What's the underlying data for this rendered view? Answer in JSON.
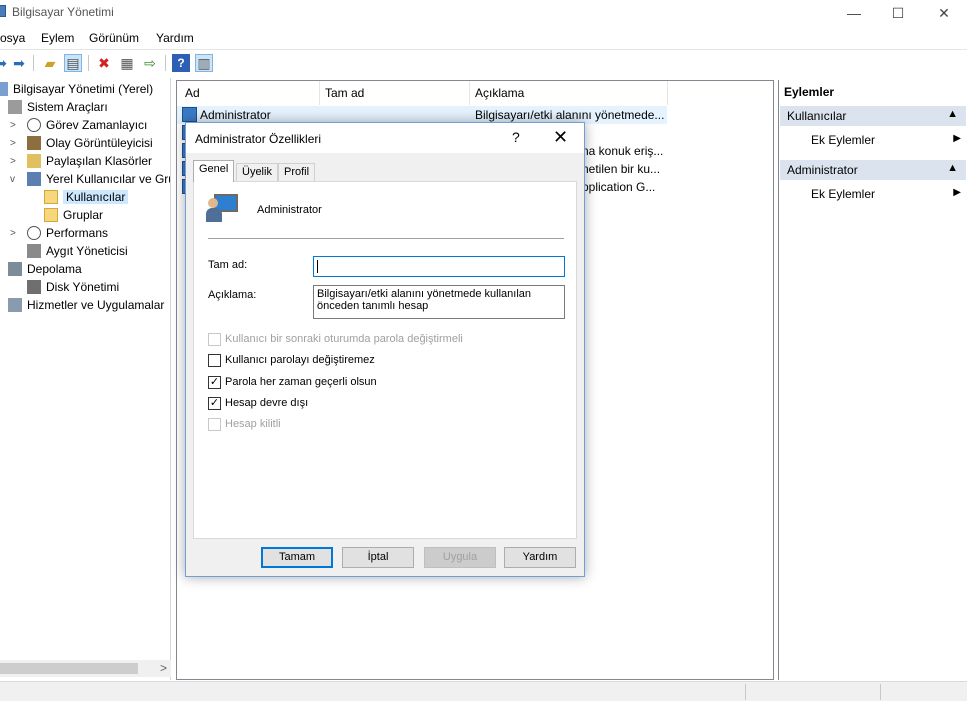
{
  "window": {
    "title": "Bilgisayar Yönetimi",
    "minimize_glyph": "—",
    "maximize_glyph": "☐",
    "close_glyph": "✕"
  },
  "menu": [
    "osya",
    "Eylem",
    "Görünüm",
    "Yardım"
  ],
  "toolbar": {
    "icons": [
      "back-icon",
      "forward-icon",
      "up-folder-icon",
      "show-hide-tree-icon",
      "delete-icon",
      "properties-icon",
      "export-icon",
      "help-icon",
      "action-pane-icon"
    ]
  },
  "tree": {
    "items": [
      {
        "label": "Bilgisayar Yönetimi (Yerel)",
        "icon": "computer-management-icon"
      },
      {
        "label": "Sistem Araçları",
        "icon": "tools-icon",
        "toggle": ""
      },
      {
        "label": "Görev Zamanlayıcı",
        "icon": "clock-icon",
        "toggle": ">"
      },
      {
        "label": "Olay Görüntüleyicisi",
        "icon": "event-viewer-icon",
        "toggle": ">"
      },
      {
        "label": "Paylaşılan Klasörler",
        "icon": "shared-folder-icon",
        "toggle": ">"
      },
      {
        "label": "Yerel Kullanıcılar ve Gru",
        "icon": "users-group-icon",
        "toggle": "v"
      },
      {
        "label": "Kullanıcılar",
        "icon": "folder-icon"
      },
      {
        "label": "Gruplar",
        "icon": "folder-icon"
      },
      {
        "label": "Performans",
        "icon": "performance-icon",
        "toggle": ">"
      },
      {
        "label": "Aygıt Yöneticisi",
        "icon": "device-manager-icon"
      },
      {
        "label": "Depolama",
        "icon": "storage-icon"
      },
      {
        "label": "Disk Yönetimi",
        "icon": "disk-icon"
      },
      {
        "label": "Hizmetler ve Uygulamalar",
        "icon": "services-icon"
      }
    ],
    "scroll_right": ">"
  },
  "list": {
    "columns": [
      "Ad",
      "Tam ad",
      "Açıklama"
    ],
    "rows": [
      {
        "name": "Administrator",
        "full_name": "",
        "description": "Bilgisayarı/etki alanını yönetmede..."
      },
      {
        "name": "",
        "full_name": "",
        "description": ""
      },
      {
        "name": "",
        "full_name": "",
        "description": "na konuk eriş..."
      },
      {
        "name": "",
        "full_name": "",
        "description": "netilen bir ku..."
      },
      {
        "name": "",
        "full_name": "",
        "description": "pplication G..."
      }
    ]
  },
  "actions": {
    "title": "Eylemler",
    "sections": [
      {
        "header": "Kullanıcılar",
        "items": [
          "Ek Eylemler"
        ]
      },
      {
        "header": "Administrator",
        "items": [
          "Ek Eylemler"
        ]
      }
    ]
  },
  "dialog": {
    "title": "Administrator Özellikleri",
    "help_glyph": "?",
    "close_glyph": "✕",
    "tabs": [
      "Genel",
      "Üyelik",
      "Profil"
    ],
    "user_name": "Administrator",
    "full_name_label": "Tam ad:",
    "full_name_value": "",
    "description_label": "Açıklama:",
    "description_value": "Bilgisayarı/etki alanını yönetmede kullanılan önceden tanımlı hesap",
    "checkboxes": [
      {
        "label": "Kullanıcı bir sonraki oturumda parola değiştirmeli",
        "checked": false,
        "disabled": true
      },
      {
        "label": "Kullanıcı parolayı değiştiremez",
        "checked": false,
        "disabled": false
      },
      {
        "label": "Parola her zaman geçerli olsun",
        "checked": true,
        "disabled": false
      },
      {
        "label": "Hesap devre dışı",
        "checked": true,
        "disabled": false
      },
      {
        "label": "Hesap kilitli",
        "checked": false,
        "disabled": true
      }
    ],
    "check_glyph": "✓",
    "buttons": {
      "ok": "Tamam",
      "cancel": "İptal",
      "apply": "Uygula",
      "help": "Yardım"
    }
  },
  "colors": {
    "accent": "#0078d7",
    "selection": "#cce8ff",
    "action_section": "#dbe4ee"
  }
}
